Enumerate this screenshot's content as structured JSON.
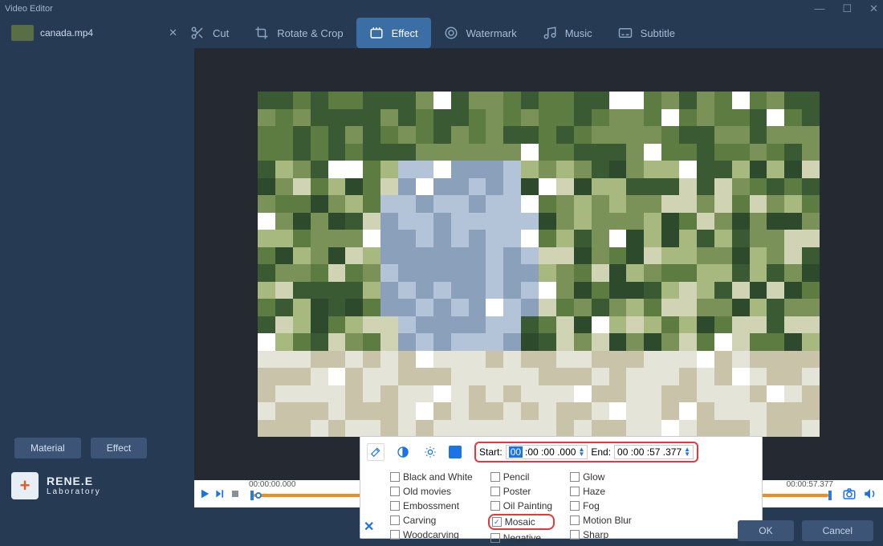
{
  "app_title": "Video Editor",
  "file_tab": {
    "name": "canada.mp4"
  },
  "tabs": [
    {
      "label": "Cut",
      "icon": "scissors",
      "active": false
    },
    {
      "label": "Rotate & Crop",
      "icon": "crop",
      "active": false
    },
    {
      "label": "Effect",
      "icon": "sparkle",
      "active": true
    },
    {
      "label": "Watermark",
      "icon": "stamp",
      "active": false
    },
    {
      "label": "Music",
      "icon": "music",
      "active": false
    },
    {
      "label": "Subtitle",
      "icon": "subtitle",
      "active": false
    }
  ],
  "sidebar": {
    "buttons": [
      {
        "label": "Material"
      },
      {
        "label": "Effect"
      }
    ]
  },
  "brand": {
    "line1": "RENE.E",
    "line2": "Laboratory",
    "icon": "+"
  },
  "timeline": {
    "start": "00:00:00.000",
    "range": "00:00:00.000-00:00:57.377",
    "end": "00:00:57.377"
  },
  "effect_panel": {
    "start_label": "Start:",
    "start_value": "00 :00 :00 .000",
    "start_hh": "00",
    "end_label": "End:",
    "end_value": "00 :00 :57 .377",
    "effects": [
      [
        "Black and White",
        "Old movies",
        "Embossment",
        "Carving",
        "Woodcarving"
      ],
      [
        "Pencil",
        "Poster",
        "Oil Painting",
        "Mosaic",
        "Negative"
      ],
      [
        "Glow",
        "Haze",
        "Fog",
        "Motion Blur",
        "Sharp"
      ]
    ],
    "selected": "Mosaic"
  },
  "footer": {
    "ok": "OK",
    "cancel": "Cancel"
  }
}
